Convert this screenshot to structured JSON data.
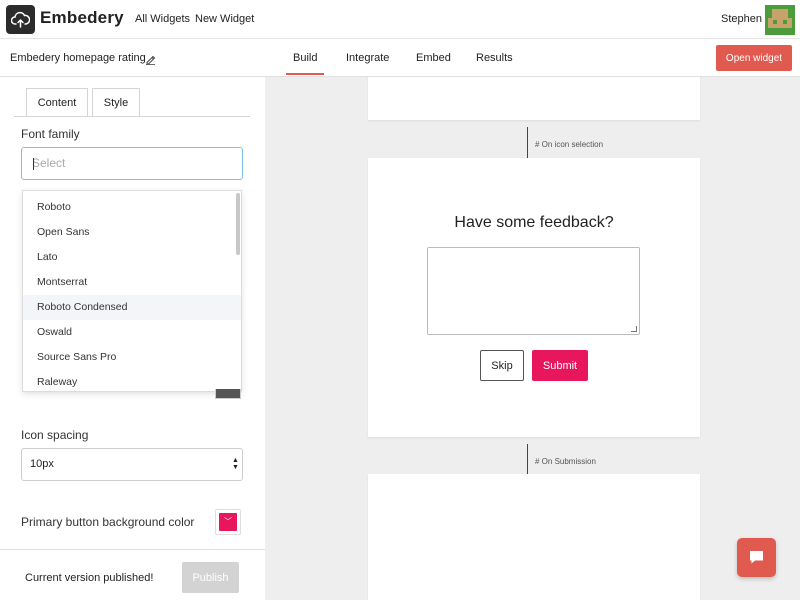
{
  "nav": {
    "brand": "Embedery",
    "links": [
      "All Widgets",
      "New Widget"
    ],
    "user": "Stephen"
  },
  "subheader": {
    "widget_name": "Embedery homepage rating",
    "tabs": [
      "Build",
      "Integrate",
      "Embed",
      "Results"
    ],
    "active_tab": "Build",
    "open_widget": "Open widget"
  },
  "panel": {
    "tabs": [
      "Content",
      "Style"
    ],
    "active_tab": "Style",
    "font_family_label": "Font family",
    "font_family_placeholder": "Select",
    "font_options": [
      "Roboto",
      "Open Sans",
      "Lato",
      "Montserrat",
      "Roboto Condensed",
      "Oswald",
      "Source Sans Pro",
      "Raleway"
    ],
    "highlighted_option": "Roboto Condensed",
    "icon_spacing_label": "Icon spacing",
    "icon_spacing_value": "10px",
    "primary_bg_label": "Primary button background color",
    "primary_bg_color": "#e8175d",
    "status": "Current version published!",
    "publish": "Publish"
  },
  "canvas": {
    "on_icon_selection": "# On icon selection",
    "question": "Have some feedback?",
    "skip": "Skip",
    "submit": "Submit",
    "on_submission": "# On Submission"
  },
  "colors": {
    "accent": "#e05a50",
    "primary": "#e8175d",
    "focus": "#7cc4e8"
  }
}
